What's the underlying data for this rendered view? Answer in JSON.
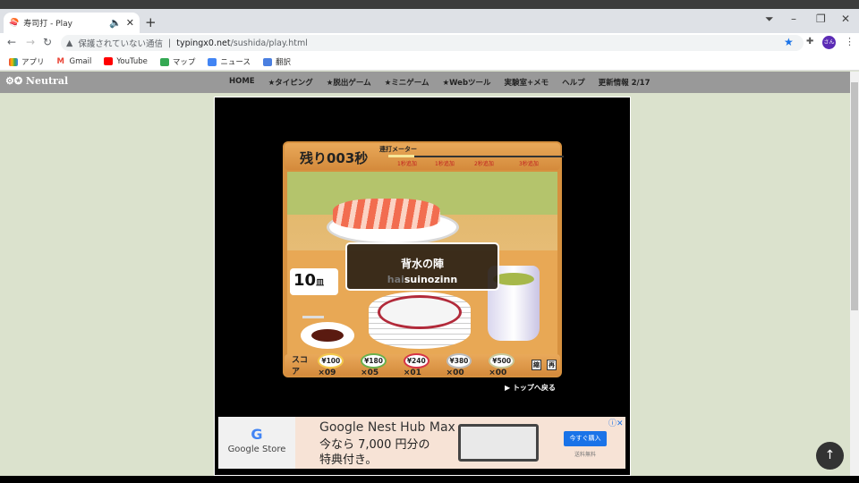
{
  "browser": {
    "tab_title": "寿司打 - Play",
    "tab_icons": [
      "sushi-favicon",
      "speaker-icon",
      "close-icon"
    ],
    "new_tab": "+",
    "window_controls": [
      "–",
      "❐",
      "✕"
    ],
    "security": "保護されていない通信",
    "url_domain": "typingx0.net",
    "url_path": "/sushida/play.html",
    "profile": "さん",
    "bookmarks": [
      "アプリ",
      "Gmail",
      "YouTube",
      "マップ",
      "ニュース",
      "翻訳"
    ]
  },
  "site": {
    "logo": "Neutral",
    "menu": [
      "HOME",
      "★タイピング",
      "★脱出ゲーム",
      "★ミニゲーム",
      "★Webツール",
      "実験室+メモ",
      "ヘルプ",
      "更新情報 2/17"
    ]
  },
  "game": {
    "remaining": "残り003秒",
    "meter_label": "連打メーター",
    "meter_fraction": 0.15,
    "bonuses": [
      "1秒追加",
      "1秒追加",
      "2秒追加",
      "3秒追加"
    ],
    "word_jp": "背水の陣",
    "romaji_typed": "hai",
    "romaji_rest": "suinozinn",
    "plates": "10",
    "plates_unit": "皿",
    "score_label": "スコア",
    "scores": [
      {
        "price": "¥100",
        "count": "×09",
        "color": "#f2c94c"
      },
      {
        "price": "¥180",
        "count": "×05",
        "color": "#6ab04c"
      },
      {
        "price": "¥240",
        "count": "×01",
        "color": "#d63447"
      },
      {
        "price": "¥380",
        "count": "×00",
        "color": "#bbbbbb"
      },
      {
        "price": "¥500",
        "count": "×00",
        "color": "#c8c89a"
      }
    ],
    "icons": [
      "縮",
      "再"
    ],
    "back": "▶ トップへ戻る"
  },
  "ad": {
    "brand": "Google Store",
    "headline": "Google Nest Hub Max",
    "text1": "今なら 7,000 円分の",
    "text2": "特典付き。",
    "button": "今すぐ購入",
    "sub": "送料無料",
    "close": "ⓘ✕"
  },
  "to_top": "↑"
}
